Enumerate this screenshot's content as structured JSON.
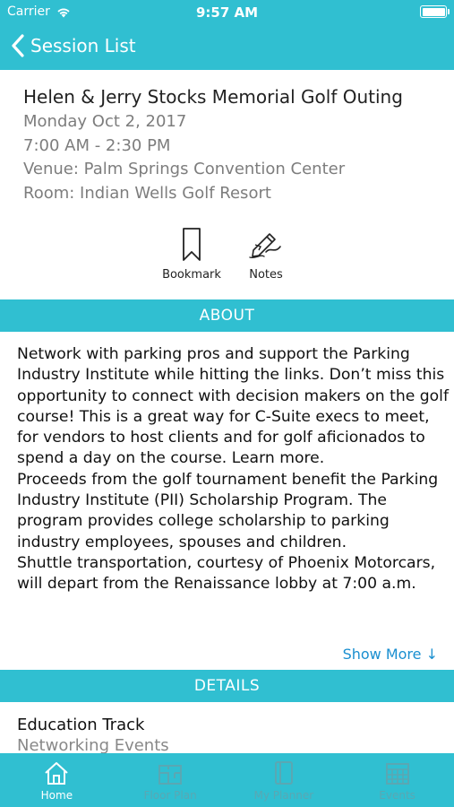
{
  "status_bar": {
    "carrier": "Carrier",
    "time": "9:57 AM",
    "battery_level": 1.0
  },
  "nav": {
    "back_label": "Session List"
  },
  "session": {
    "title": "Helen & Jerry Stocks Memorial Golf Outing",
    "date": "Monday Oct 2, 2017",
    "time": "7:00 AM - 2:30 PM",
    "venue": "Venue: Palm Springs Convention Center",
    "room": "Room: Indian Wells Golf Resort"
  },
  "actions": {
    "bookmark_label": "Bookmark",
    "notes_label": "Notes"
  },
  "about": {
    "header": "ABOUT",
    "paragraphs": [
      "Network with parking pros and support the Parking Industry Institute while hitting the links. Don’t miss this opportunity to connect with decision makers on the golf course! This is a great way for C-Suite execs to meet, for vendors to host clients and for golf aficionados to spend a day on the course. Learn more.",
      "Proceeds from the golf tournament benefit the Parking Industry Institute (PII) Scholarship Program. The program provides college scholarship to parking industry employees, spouses and children.",
      "Shuttle transportation, courtesy of Phoenix Motorcars, will depart from the Renaissance lobby at 7:00 a.m."
    ],
    "show_more": "Show More ↓"
  },
  "details": {
    "header": "DETAILS",
    "track_label": "Education Track",
    "track_value": "Networking Events"
  },
  "tabs": [
    {
      "label": "Home",
      "icon": "home-icon",
      "active": true
    },
    {
      "label": "Floor Plan",
      "icon": "floor-plan-icon",
      "active": false
    },
    {
      "label": "My Planner",
      "icon": "planner-icon",
      "active": false
    },
    {
      "label": "Events",
      "icon": "calendar-icon",
      "active": false
    }
  ],
  "colors": {
    "accent": "#30bfd1",
    "link": "#1a8fd0",
    "inactive_tab": "#5aa7b3"
  }
}
